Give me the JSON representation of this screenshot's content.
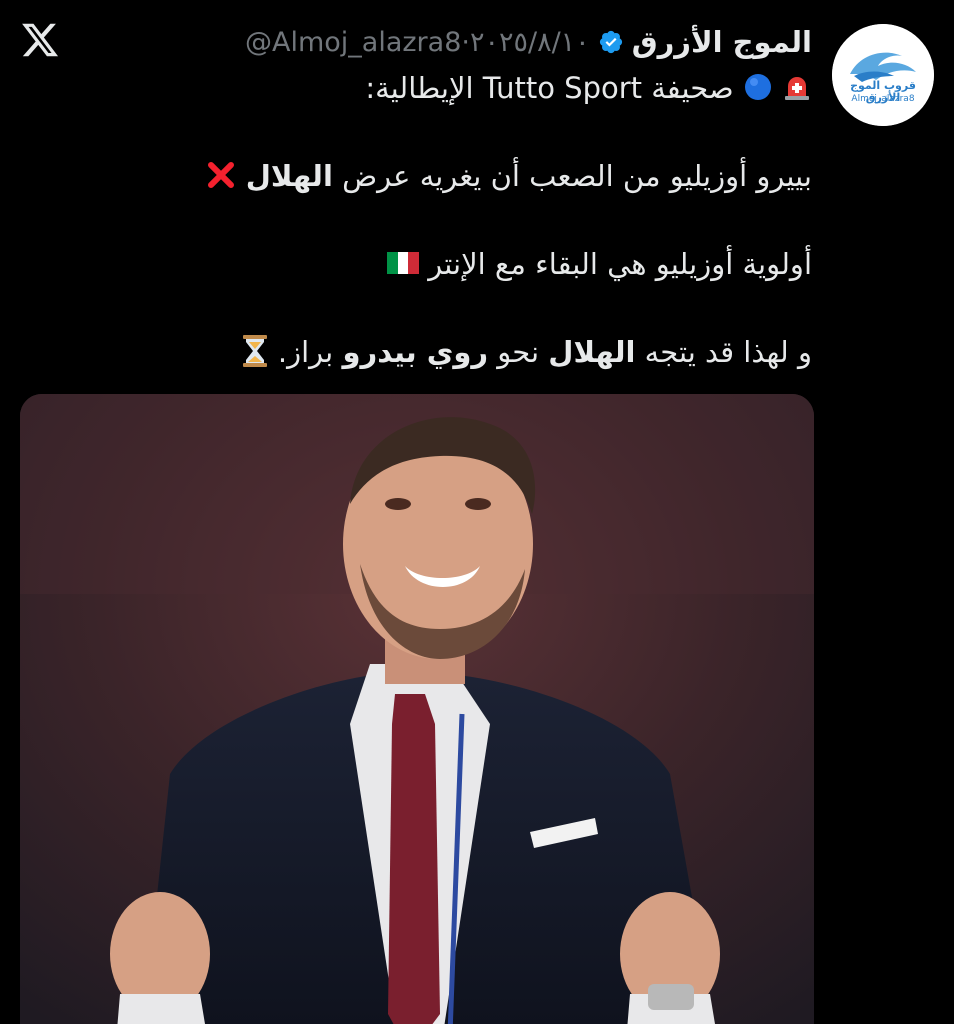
{
  "header": {
    "display_name": "الموج الأزرق",
    "handle": "@Almoj_alazra8",
    "separator": "·",
    "date": "٢٠٢٥/٨/١٠"
  },
  "avatar": {
    "logo_text": "قروب الموج الأزرق",
    "logo_handle": "Almoj_alazra8"
  },
  "tweet": {
    "line1": {
      "prefix": "صحيفة ",
      "source": "Tutto Sport",
      "suffix": " الإيطالية:"
    },
    "line2": {
      "text": "بييرو أوزيليو من الصعب أن يغريه عرض ",
      "club": "الهلال"
    },
    "line3": {
      "text": "أولوية أوزيليو هي البقاء مع الإنتر"
    },
    "line4": {
      "start": "و لهذا قد يتجه ",
      "club": "الهلال",
      "middle": " نحو ",
      "name": "روي بيدرو",
      "end": " براز."
    }
  },
  "icons": {
    "x_logo": "x-logo-icon",
    "verified": "verified-badge-icon",
    "siren": "rotating-light-emoji",
    "blue_circle": "blue-circle-emoji",
    "cross_mark": "cross-mark-emoji",
    "italy_flag": "italy-flag-emoji",
    "hourglass": "hourglass-emoji"
  },
  "colors": {
    "background": "#000000",
    "text": "#e7e9ea",
    "muted": "#71767b",
    "verified_blue": "#1d9bf0",
    "cross_red": "#f4212e"
  }
}
